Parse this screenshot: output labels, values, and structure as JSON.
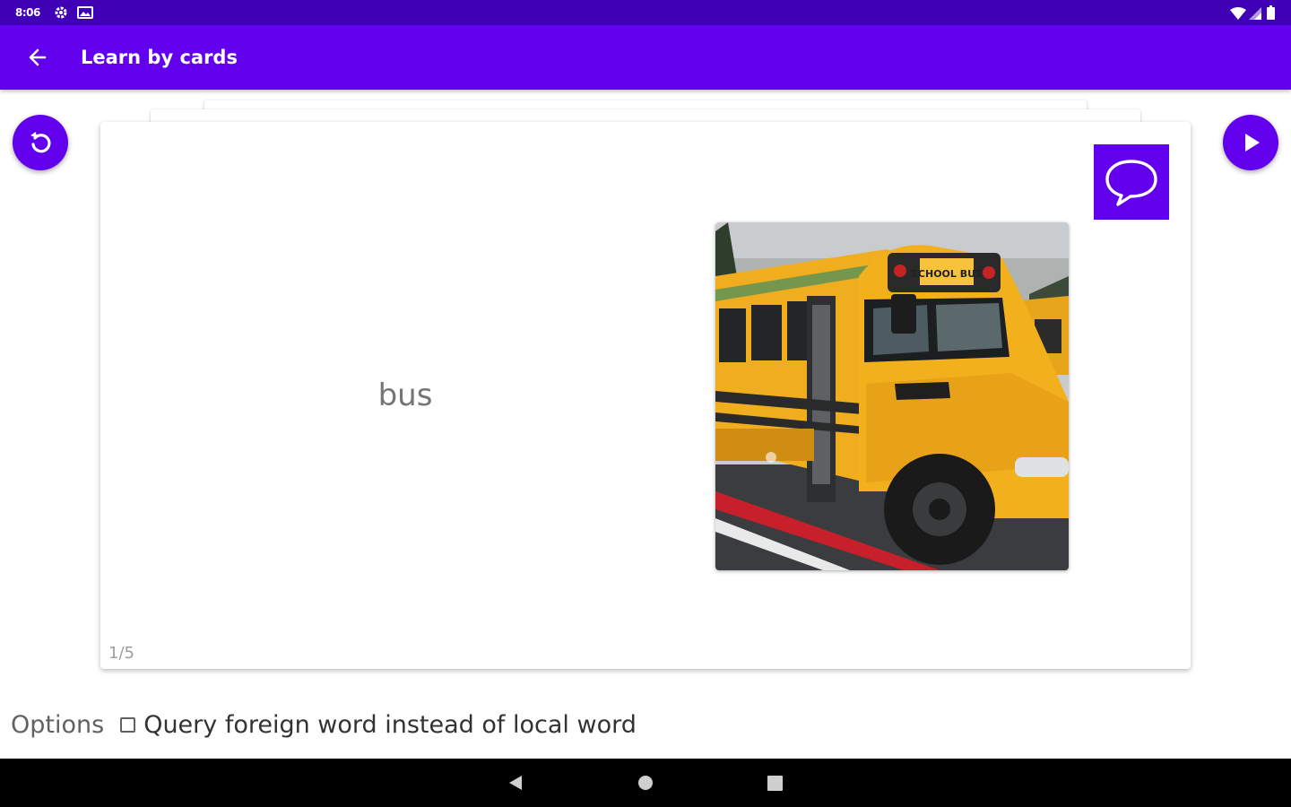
{
  "status_bar": {
    "time": "8:06",
    "icons": [
      "gear-icon",
      "image-icon",
      "wifi-icon",
      "signal-icon",
      "battery-icon"
    ]
  },
  "app_bar": {
    "title": "Learn by cards",
    "back_icon": "arrow-left-icon",
    "color": "#6200ee"
  },
  "controls": {
    "restart_icon": "restart-icon",
    "play_icon": "play-icon"
  },
  "card": {
    "word": "bus",
    "image_icon": "school-bus-photo",
    "image_text": "SCHOOL BUS",
    "speak_icon": "speech-bubble-icon",
    "counter": "1/5"
  },
  "options": {
    "label": "Options",
    "checkbox_label": "Query foreign word instead of local word",
    "checked": false
  },
  "nav_bar": {
    "icons": [
      "back-triangle-icon",
      "home-circle-icon",
      "recents-square-icon"
    ]
  },
  "colors": {
    "status_bar": "#3f00b6",
    "accent": "#6200ee"
  }
}
